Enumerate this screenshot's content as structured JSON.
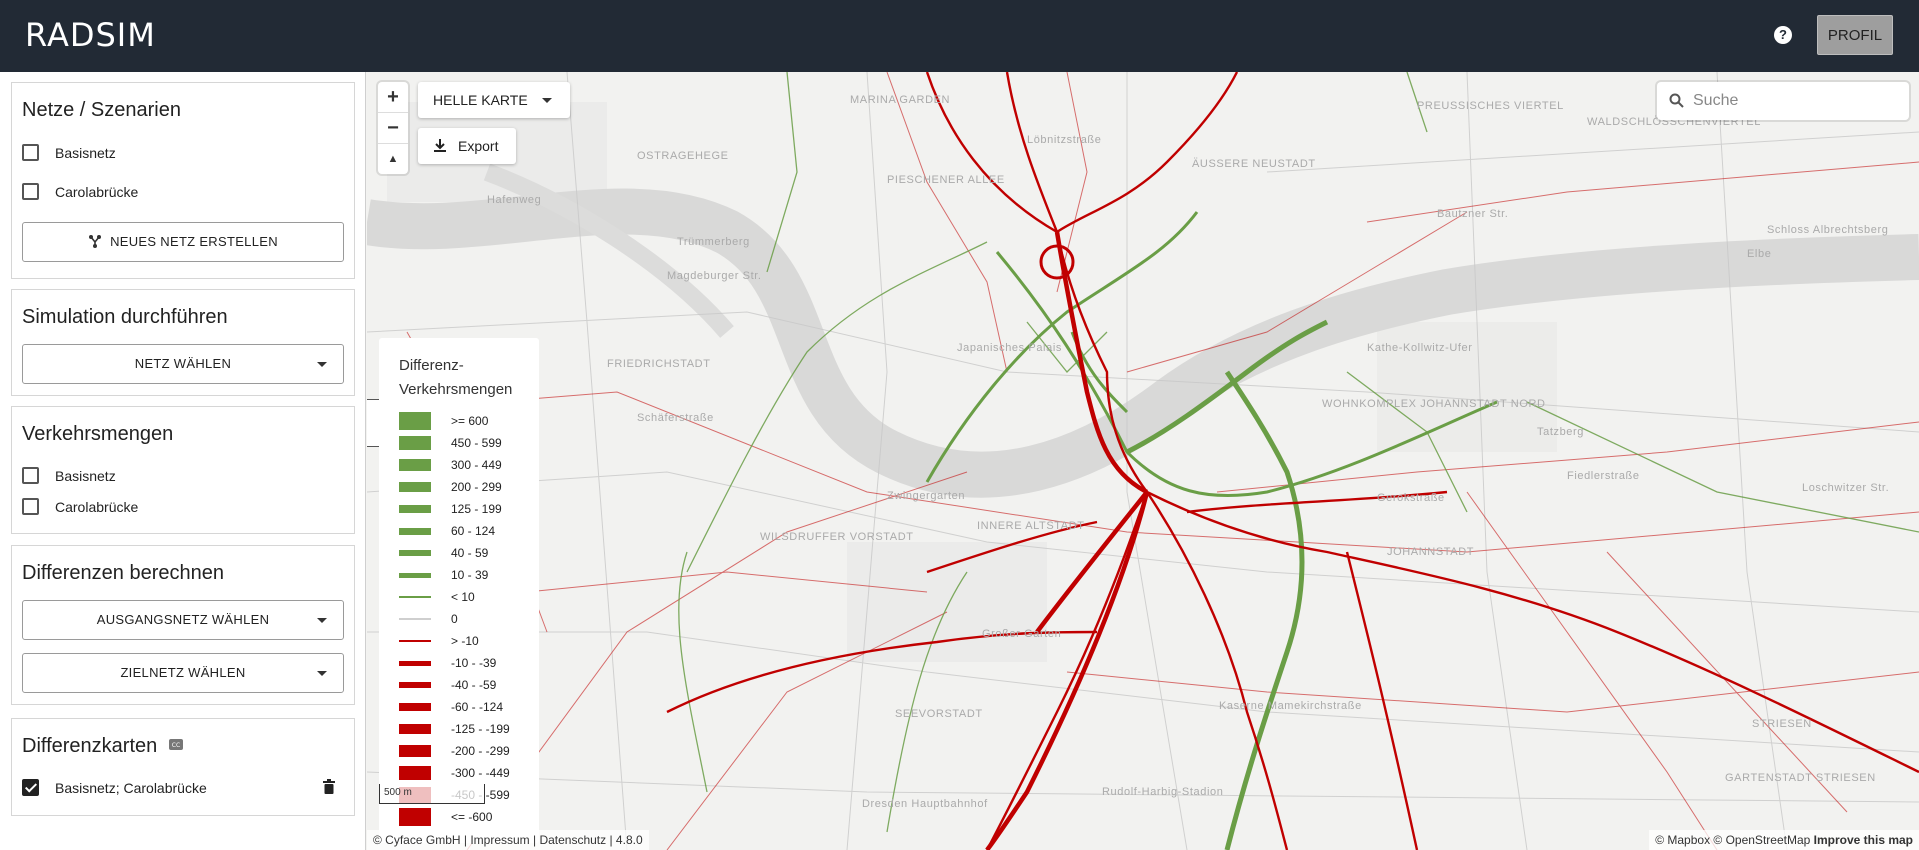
{
  "header": {
    "logo": "RADSIM",
    "help_icon": "help-circle-icon",
    "help_glyph": "?",
    "profile_label": "PROFIL"
  },
  "sidebar": {
    "networks": {
      "title": "Netze / Szenarien",
      "items": [
        {
          "label": "Basisnetz",
          "checked": false
        },
        {
          "label": "Carolabrücke",
          "checked": false
        }
      ],
      "create_label": "NEUES NETZ ERSTELLEN",
      "create_icon": "network-fork-icon"
    },
    "simulation": {
      "title": "Simulation durchführen",
      "select_label": "NETZ WÄHLEN"
    },
    "traffic": {
      "title": "Verkehrsmengen",
      "items": [
        {
          "label": "Basisnetz",
          "checked": false
        },
        {
          "label": "Carolabrücke",
          "checked": false
        }
      ]
    },
    "differences": {
      "title": "Differenzen berechnen",
      "source_label": "AUSGANGSNETZ WÄHLEN",
      "target_label": "ZIELNETZ WÄHLEN"
    },
    "diffmaps": {
      "title": "Differenzkarten",
      "title_icon": "cc-icon",
      "items": [
        {
          "label": "Basisnetz; Carolabrücke",
          "checked": true
        }
      ],
      "delete_icon": "trash-icon"
    }
  },
  "map": {
    "zoom_in": "+",
    "zoom_out": "−",
    "compass": "▲",
    "layer_select": "HELLE KARTE",
    "export_label": "Export",
    "search_placeholder": "Suche",
    "collapse_glyph": "‹",
    "scale": "500 m",
    "attribution_left": "© Cyface GmbH | Impressum | Datenschutz | 4.8.0",
    "attribution_right_1": "© Mapbox © OpenStreetMap ",
    "attribution_right_2": "Improve this map",
    "colors": {
      "green": "#6a9e46",
      "red": "#c00000",
      "zero": "#cfcfcf",
      "river": "#d6d6d6"
    },
    "labels": [
      "MARINA GARDEN",
      "OSTRAGEHEGE",
      "PIESCHENER ALLEE",
      "FRIEDRICHSTADT",
      "WILSDRUFFER VORSTADT",
      "INNERE ALTSTADT",
      "SEEVORSTADT",
      "JOHANNSTADT",
      "ÄUSSERE NEUSTADT",
      "PREUSSISCHES VIERTEL",
      "WALDSCHLÖSSCHENVIERTEL",
      "WOHNKOMPLEX JOHANNSTADT NORD",
      "STRIESEN",
      "GARTENSTADT STRIESEN",
      "Elbe",
      "Trümmerberg",
      "Japanisches Palais",
      "Zwingergarten",
      "Großer Garten",
      "Dresden Hauptbahnhof",
      "Rudolf-Harbig-Stadion",
      "Kaserne Mamekirchstraße",
      "Tatzberg",
      "Gerokstraße",
      "Fiedlerstraße",
      "Loschwitzer Str.",
      "Kathe-Kollwitz-Ufer",
      "Bautzner Str.",
      "Hafenweg",
      "Magdeburger Str.",
      "Schäferstraße",
      "Löbnitzstraße",
      "Schloss Albrechtsberg"
    ]
  },
  "legend": {
    "title": "Differenz-Verkehrsmengen",
    "items": [
      {
        "label": ">= 600",
        "type": "green",
        "thickness": 18
      },
      {
        "label": "450 - 599",
        "type": "green",
        "thickness": 14
      },
      {
        "label": "300 - 449",
        "type": "green",
        "thickness": 12
      },
      {
        "label": "200 - 299",
        "type": "green",
        "thickness": 10
      },
      {
        "label": "125 - 199",
        "type": "green",
        "thickness": 8
      },
      {
        "label": "60 - 124",
        "type": "green",
        "thickness": 7
      },
      {
        "label": "40 - 59",
        "type": "green",
        "thickness": 6
      },
      {
        "label": "10 - 39",
        "type": "green",
        "thickness": 5
      },
      {
        "label": "< 10",
        "type": "green",
        "thickness": 2
      },
      {
        "label": "0",
        "type": "zero",
        "thickness": 2
      },
      {
        "label": "> -10",
        "type": "red",
        "thickness": 2
      },
      {
        "label": "-10 - -39",
        "type": "red",
        "thickness": 5
      },
      {
        "label": "-40 - -59",
        "type": "red",
        "thickness": 6
      },
      {
        "label": "-60 - -124",
        "type": "red",
        "thickness": 8
      },
      {
        "label": "-125 - -199",
        "type": "red",
        "thickness": 10
      },
      {
        "label": "-200 - -299",
        "type": "red",
        "thickness": 12
      },
      {
        "label": "-300 - -449",
        "type": "red",
        "thickness": 14
      },
      {
        "label": "-450 - -599",
        "type": "red",
        "thickness": 16
      },
      {
        "label": "<= -600",
        "type": "red",
        "thickness": 18
      }
    ]
  }
}
